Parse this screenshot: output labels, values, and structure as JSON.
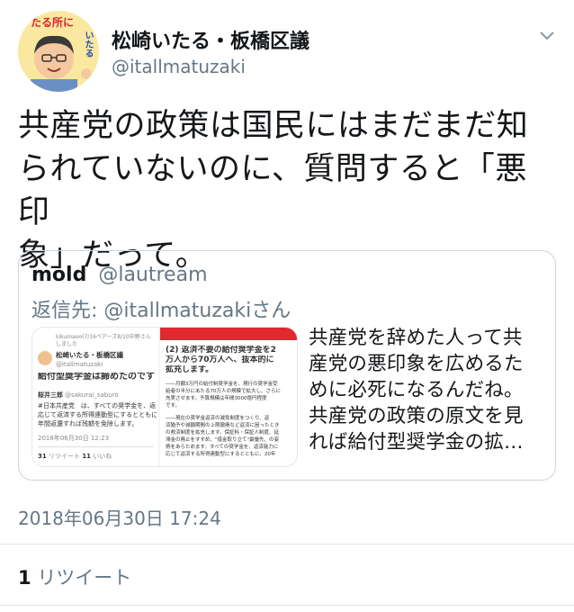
{
  "author": {
    "name": "松崎いたる・板橋区議",
    "handle": "@itallmatuzaki",
    "avatar_text_top": "たる所に",
    "avatar_text_side": "いたる"
  },
  "tweet": {
    "text_lines": [
      "共産党の政策は国民にはまだまだ知",
      "られていないのに、質問すると「悪印",
      "象」だって。"
    ],
    "timestamp": "2018年06月30日 17:24",
    "retweet_count": "1",
    "retweet_label": "リツイート"
  },
  "quote": {
    "name": "mold",
    "handle": "@lautream",
    "reply_prefix": "返信先:",
    "reply_handle": "@itallmatuzaki",
    "reply_suffix": "さん",
    "text_lines": [
      "共産党を辞めた人って共",
      "産党の悪印象を広めるた",
      "めに必死になるんだね。",
      "共産党の政策の原文を見",
      "れば給付型奨学金の拡…"
    ],
    "media": {
      "left": {
        "header": "kikumaoo(7/16ペアーズ8/10中野さん",
        "header2": "しました",
        "name": "松崎いたる・板橋区議",
        "handle": "@itallmatuzaki",
        "title": "給付型奨学金は諦めたのです",
        "reply_name": "桜井三郎",
        "reply_handle": "@sakurai_saburo",
        "body1": "#日本共産党　は、すべての奨学金を、返",
        "body2": "応じて返済する所得連動型にするとともに",
        "body3": "年間返還すれば残額を免除します。",
        "date": "2018年06月30日 12:23",
        "stats_rt": "31",
        "stats_rt_label": "リツイート",
        "stats_like": "11",
        "stats_like_label": "いいね"
      },
      "right": {
        "heading1": "(2) 返済不要の給付奨学金を2",
        "heading2": "万人から70万人へ、抜本的に",
        "heading3": "拡充します。",
        "p1": "――月額3万円の給付制奨学金を、現行の奨学金受",
        "p2": "給者の半分にあたる70万人の規模で拡大し、さらに",
        "p3": "充実させます。予算規模は年間3000億円程度",
        "p4": "です。",
        "p5": "――現在の奨学金返済の減免制度をつくり、返",
        "p6": "済猶予や減額期間の上限撤廃など返済に困ったとき",
        "p7": "の救済制度を拡充します。保証料・保証人制度、延",
        "p8": "滞金の廃止をすすめ、\"借金取り立て\"最優先、の姿",
        "p9": "勢をあらためます。すべての奨学金を、返済能力に",
        "p10": "応じて返済する所得連動型にするとともに、20年"
      }
    }
  },
  "colors": {
    "primary_text": "#14171a",
    "secondary_text": "#657786",
    "border": "#ccd6dd",
    "accent_red": "#e0282e"
  }
}
